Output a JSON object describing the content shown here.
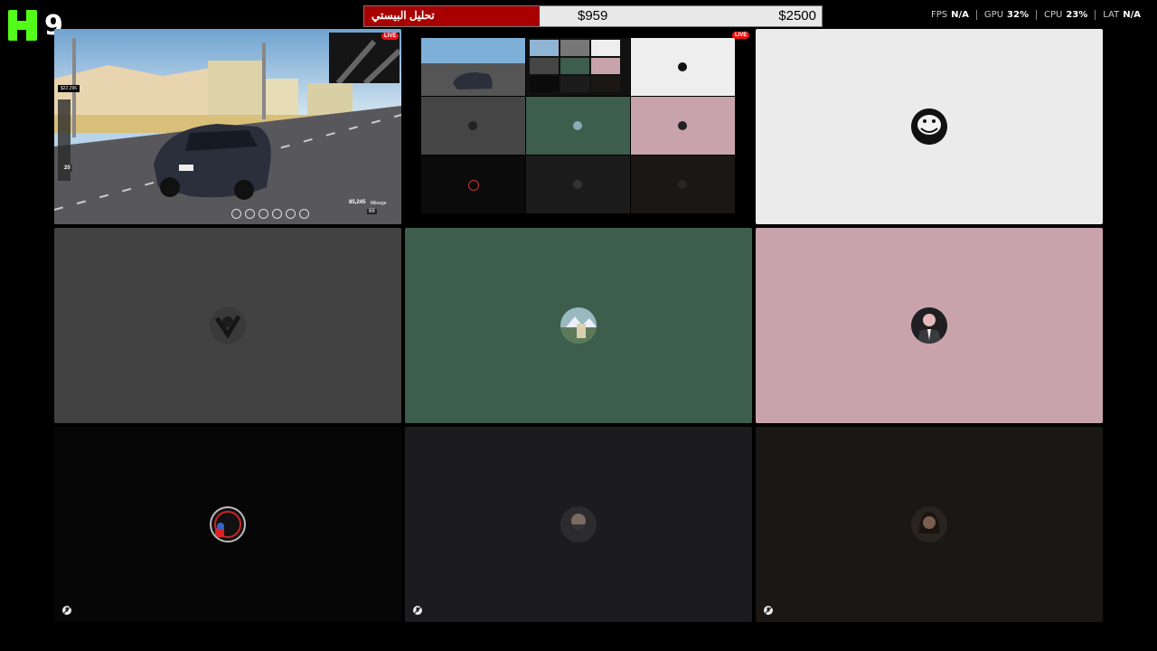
{
  "logo": {
    "viewer_count": "9"
  },
  "goal_bar": {
    "label": "تحليل البيستي",
    "current": "$959",
    "target": "$2500",
    "progress_fraction": 0.3836,
    "fill_color": "#a80000"
  },
  "stats": [
    {
      "label": "FPS",
      "value": "N/A"
    },
    {
      "label": "GPU",
      "value": "32%"
    },
    {
      "label": "CPU",
      "value": "23%"
    },
    {
      "label": "LAT",
      "value": "N/A"
    }
  ],
  "tiles": {
    "game": {
      "live_badge": "LIVE",
      "hud_money": "$22,296",
      "hud_speed": "85,245",
      "hud_mileage": "Mileage",
      "hud_gear": "68",
      "hud_level": "20",
      "icon": "car-scene"
    },
    "grid_preview": {
      "live_badge": "LIVE",
      "colors": [
        "#eeeeee",
        "#454545",
        "#3d5d4d",
        "#c9a3ab",
        "#0b0b0b",
        "#1c1c1c",
        "#1a1715"
      ]
    },
    "p1": {
      "bg": "#ebebeb",
      "icon": "trollface-avatar"
    },
    "p2": {
      "bg": "#424242",
      "icon": "dark-figure-avatar"
    },
    "p3": {
      "bg": "#3d5d4d",
      "icon": "landscape-avatar"
    },
    "p4": {
      "bg": "#c9a3ab",
      "icon": "man-in-suit-avatar"
    },
    "p5": {
      "bg": "#060606",
      "icon": "red-circle-avatar",
      "muted": true
    },
    "p6": {
      "bg": "#1c1c1e",
      "icon": "bearded-man-avatar",
      "muted": true
    },
    "p7": {
      "bg": "#1a1715",
      "icon": "long-hair-man-avatar",
      "muted": true
    }
  }
}
